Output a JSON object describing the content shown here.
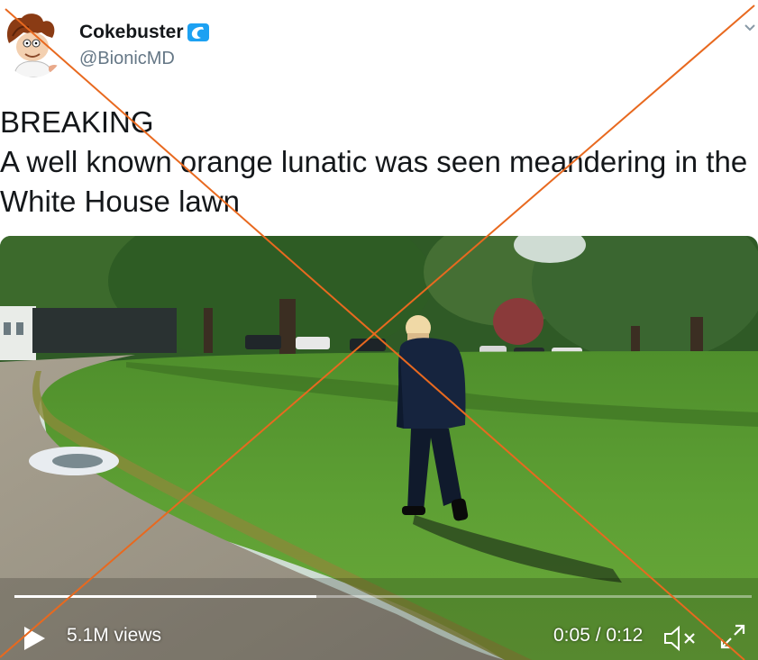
{
  "tweet": {
    "display_name": "Cokebuster",
    "badge_icon": "wave-icon",
    "handle": "@BionicMD",
    "text_line1": "BREAKING",
    "text_line2": "A well known orange lunatic was seen meandering in the White House lawn"
  },
  "video": {
    "views": "5.1M views",
    "time": "0:05 / 0:12",
    "progress": 0.41,
    "muted": true
  },
  "colors": {
    "accent_blue": "#1da1f2",
    "cross_line": "#e8691f",
    "text_primary": "#14171a",
    "text_secondary": "#657786"
  },
  "icons": {
    "menu": "chevron-down-icon",
    "play": "play-icon",
    "mute": "volume-muted-icon",
    "fullscreen": "expand-icon"
  }
}
